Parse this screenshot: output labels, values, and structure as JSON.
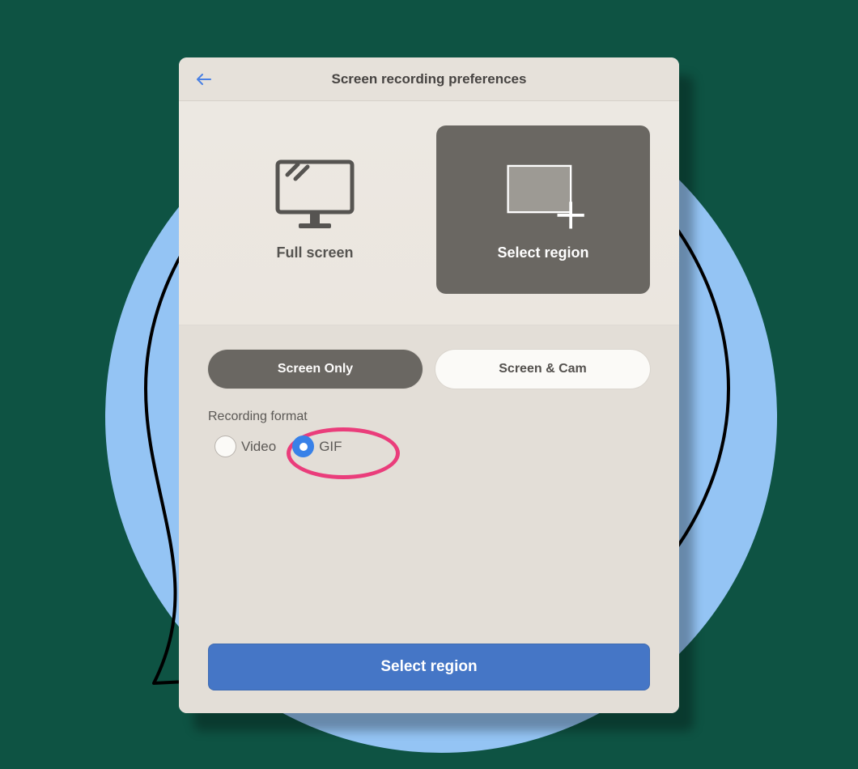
{
  "dialog": {
    "title": "Screen recording preferences",
    "area": {
      "fullscreen_label": "Full screen",
      "region_label": "Select region",
      "selected": "region"
    },
    "mode": {
      "screen_only_label": "Screen Only",
      "screen_cam_label": "Screen & Cam",
      "selected": "screen_only"
    },
    "format": {
      "section_label": "Recording format",
      "video_label": "Video",
      "gif_label": "GIF",
      "selected": "gif"
    },
    "primary_button_label": "Select region"
  },
  "annotation": {
    "highlight": "gif-radio"
  },
  "colors": {
    "page_bg": "#0e5343",
    "circle": "#94c4f4",
    "accent": "#4576c6",
    "annotation": "#ea3d7b"
  }
}
